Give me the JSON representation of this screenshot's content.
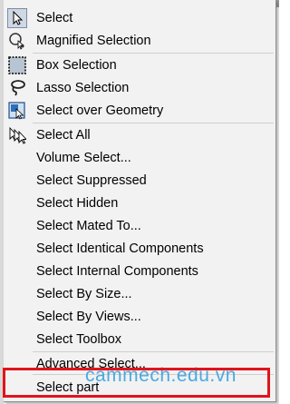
{
  "menu": {
    "items": [
      {
        "label": "Select",
        "icon": "arrow-cursor-icon"
      },
      {
        "label": "Magnified Selection",
        "icon": "magnifier-select-icon"
      },
      {
        "label": "Box Selection",
        "icon": "box-select-icon"
      },
      {
        "label": "Lasso Selection",
        "icon": "lasso-icon"
      },
      {
        "label": "Select over Geometry",
        "icon": "geometry-select-icon"
      },
      {
        "label": "Select All",
        "icon": "select-all-icon"
      },
      {
        "label": "Volume Select...",
        "icon": ""
      },
      {
        "label": "Select Suppressed",
        "icon": ""
      },
      {
        "label": "Select Hidden",
        "icon": ""
      },
      {
        "label": "Select Mated To...",
        "icon": ""
      },
      {
        "label": "Select Identical Components",
        "icon": ""
      },
      {
        "label": "Select Internal Components",
        "icon": ""
      },
      {
        "label": "Select By Size...",
        "icon": ""
      },
      {
        "label": "Select By Views...",
        "icon": ""
      },
      {
        "label": "Select Toolbox",
        "icon": ""
      },
      {
        "label": "Advanced Select...",
        "icon": ""
      },
      {
        "label": "Select part",
        "icon": ""
      }
    ]
  },
  "watermark": "cammech.edu.vn",
  "colors": {
    "highlight_border": "#e0141b",
    "watermark": "#38a3e0"
  }
}
